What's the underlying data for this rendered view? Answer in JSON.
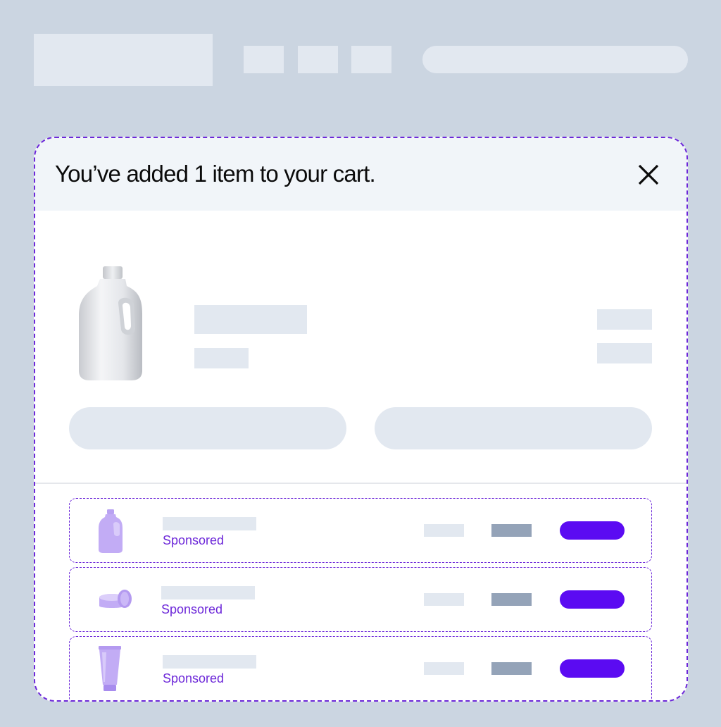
{
  "modal": {
    "title": "You’ve added 1 item to your cart.",
    "close_icon": "close-icon"
  },
  "main_product": {
    "image_icon": "detergent-bottle-image"
  },
  "sponsored_items": [
    {
      "label": "Sponsored",
      "image_icon": "purple-bottle-image"
    },
    {
      "label": "Sponsored",
      "image_icon": "purple-jar-image"
    },
    {
      "label": "Sponsored",
      "image_icon": "purple-tube-image"
    }
  ],
  "colors": {
    "page_bg": "#cbd5e1",
    "placeholder": "#e2e8f0",
    "accent_purple": "#5b0bf2",
    "dashed_outline": "#6d28d9",
    "header_bg": "#f1f5f9"
  }
}
